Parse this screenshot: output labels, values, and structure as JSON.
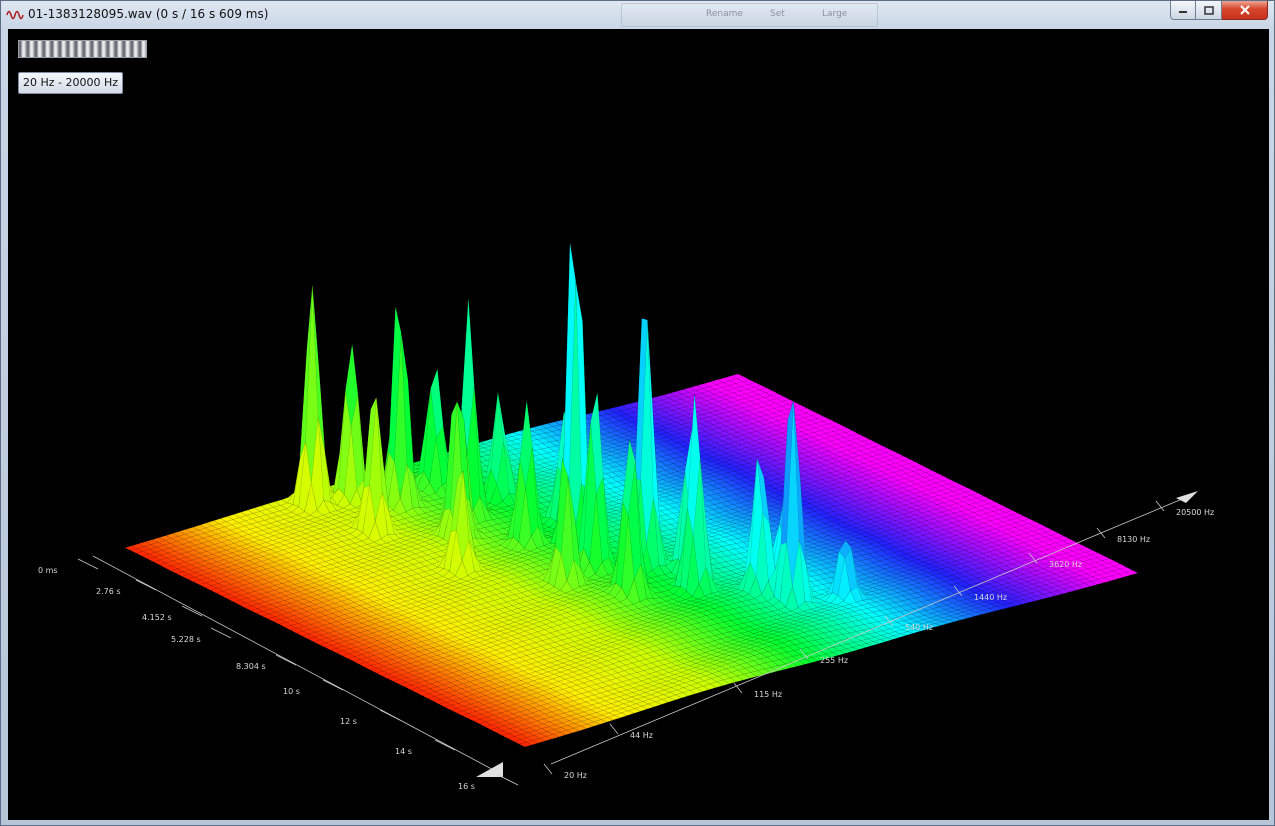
{
  "window": {
    "title": "01-1383128095.wav (0 s / 16 s 609 ms)",
    "ghost_buttons": [
      "Rename",
      "Set",
      "Large"
    ]
  },
  "controls": {
    "freq_range_label": "20 Hz - 20000 Hz"
  },
  "chart_data": {
    "type": "surface-3d",
    "time_axis": {
      "tick_labels": [
        "0 ms",
        "2.76 s",
        "4.152 s",
        "5.228 s",
        "8.304 s",
        "10 s",
        "12 s",
        "14 s",
        "16 s"
      ]
    },
    "frequency_axis": {
      "tick_labels": [
        "20 Hz",
        "44 Hz",
        "115 Hz",
        "255 Hz",
        "540 Hz",
        "1440 Hz",
        "3620 Hz",
        "8130 Hz",
        "20500 Hz"
      ]
    },
    "colormap": [
      "#ff2200",
      "#ffee00",
      "#ccff00",
      "#00ff33",
      "#00ffff",
      "#2222ff",
      "#ff00ff"
    ],
    "background_color": "#000000"
  }
}
